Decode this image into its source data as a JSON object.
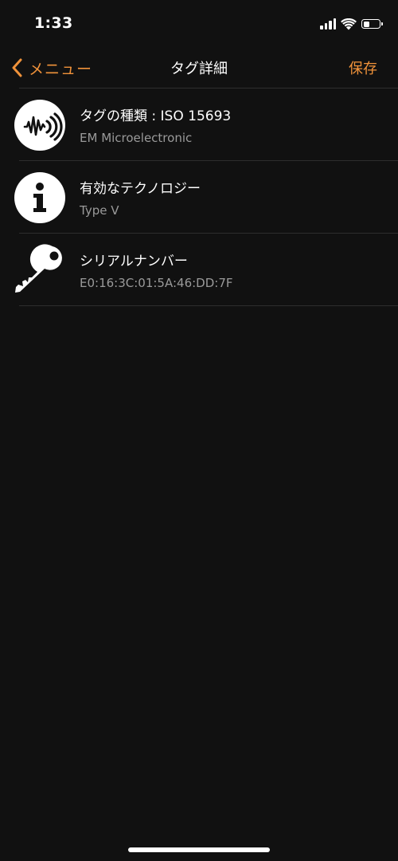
{
  "colors": {
    "accent": "#F0923A",
    "background": "#111111",
    "primary_text": "#FFFFFF",
    "secondary_text": "#9A9A9A",
    "divider": "#2E2E2E"
  },
  "status_bar": {
    "time": "1:33",
    "icons": [
      "signal-icon",
      "wifi-icon",
      "battery-icon"
    ],
    "battery_level": 0.4
  },
  "nav": {
    "back_label": "メニュー",
    "back_icon": "chevron-left-icon",
    "title": "タグ詳細",
    "save_label": "保存"
  },
  "items": [
    {
      "icon": "nfc-tag-icon",
      "title": "タグの種類 : ISO 15693",
      "subtitle": "EM Microelectronic"
    },
    {
      "icon": "info-icon",
      "title": "有効なテクノロジー",
      "subtitle": "Type V"
    },
    {
      "icon": "key-icon",
      "title": "シリアルナンバー",
      "subtitle": "E0:16:3C:01:5A:46:DD:7F"
    }
  ]
}
